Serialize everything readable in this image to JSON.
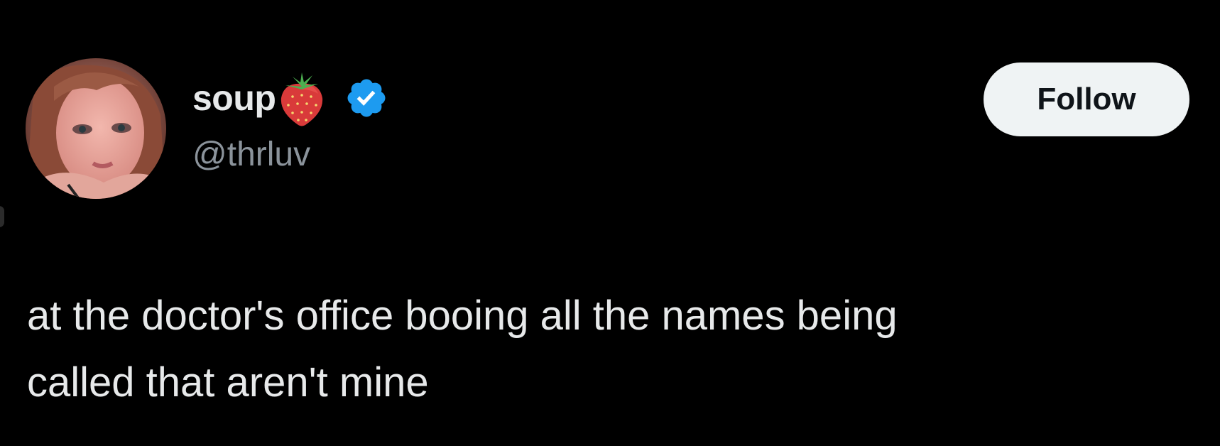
{
  "user": {
    "display_name": "soup",
    "handle": "@thrluv",
    "name_emoji_icon": "strawberry-icon",
    "verified_icon": "verified-badge-icon"
  },
  "follow_button": {
    "label": "Follow"
  },
  "tweet": {
    "lines": [
      "at the doctor's office booing all the names being",
      "called that aren't mine"
    ]
  },
  "colors": {
    "background": "#000000",
    "text_primary": "#e7e9ea",
    "text_secondary": "#8b939b",
    "verified_blue": "#1d9bf0",
    "follow_bg": "#eff3f4",
    "follow_text": "#0f1419"
  }
}
